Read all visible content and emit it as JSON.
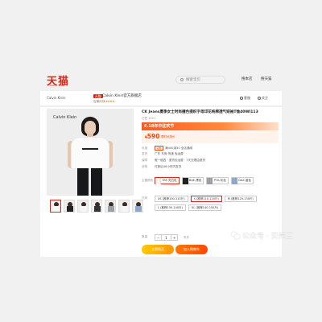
{
  "header": {
    "logo": "天猫",
    "logo_sub": "TMALL.COM",
    "search_placeholder": "搜索宝贝",
    "link_search_site": "搜本店",
    "link_search_all": "搜天猫"
  },
  "store": {
    "logo_text": "Calvin Klein",
    "tag": "天猫",
    "name": "Calvin Klein官方旗舰店",
    "rating_label": "店铺评分",
    "rating_stars": "★★★★★",
    "action_service": "客服",
    "action_follow": "关注"
  },
  "product": {
    "image_brand": "Calvin Klein",
    "title": "CK Jeans夏季女士时尚撞色提织字母印花纯棉透气短袖T恤40WI113",
    "sold_text": "已售 100+",
    "promo_banner": "6.18年中狂欢节",
    "price_symbol": "¥",
    "price": "590",
    "price_note": "限时优惠价",
    "rows": [
      {
        "key": "优惠",
        "badge": "领券",
        "value": "满400减30 全店通用"
      },
      {
        "key": "发货",
        "value": "广东 东莞 快递 免运费"
      },
      {
        "key": "保障",
        "value": "假一赔四 · 退货包运费 · 7天无理由退货"
      },
      {
        "key": "说明",
        "value": "付款后48小时内发货"
      }
    ],
    "color_label": "主要颜色",
    "colors": [
      {
        "name": "YAF-亮白色",
        "swatch": "white"
      },
      {
        "name": "BAE-黑色",
        "swatch": "black"
      },
      {
        "name": "P7A-灰色",
        "swatch": "grey"
      },
      {
        "name": "DAZ-蓝色",
        "swatch": "blue"
      }
    ],
    "size_label": "尺码",
    "sizes": [
      "XS (推荐100-110斤)",
      "S (推荐110-120斤)",
      "M (推荐120-130斤)",
      "L (推荐130-140斤)",
      "XL (推荐140-150斤)"
    ],
    "qty_label": "数量",
    "qty_value": "1",
    "qty_stock": "有货",
    "buy_now": "立即购买",
    "add_cart": "加入购物车"
  },
  "watermark": {
    "text": "公众号 · 贝壳三"
  }
}
